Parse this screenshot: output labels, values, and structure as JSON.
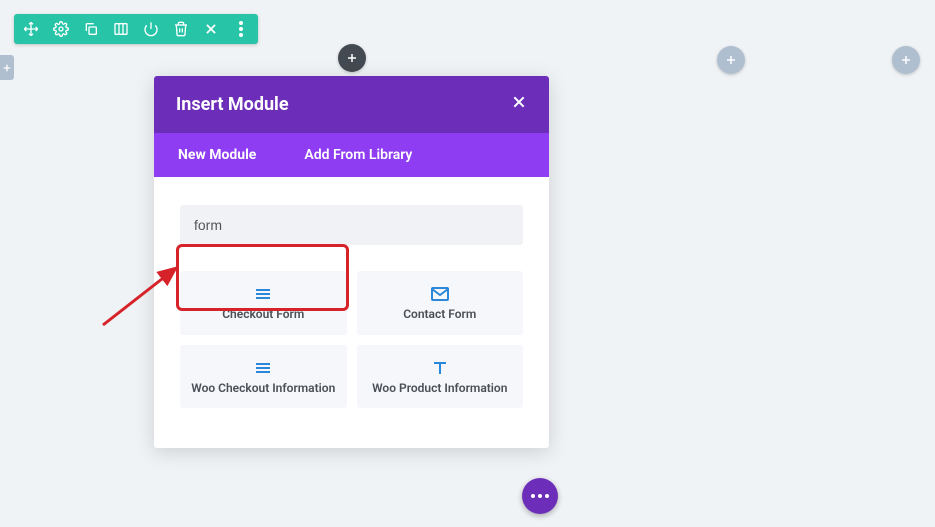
{
  "toolbar": {
    "icons": [
      "move",
      "gear",
      "duplicate",
      "columns",
      "power",
      "trash",
      "close",
      "more"
    ]
  },
  "modal": {
    "title": "Insert Module",
    "tabs": {
      "new": "New Module",
      "library": "Add From Library"
    },
    "search_value": "form"
  },
  "modules": [
    {
      "icon": "list-lines",
      "label": "Checkout Form"
    },
    {
      "icon": "envelope",
      "label": "Contact Form"
    },
    {
      "icon": "list-lines",
      "label": "Woo Checkout Information"
    },
    {
      "icon": "text-t",
      "label": "Woo Product Information"
    }
  ]
}
